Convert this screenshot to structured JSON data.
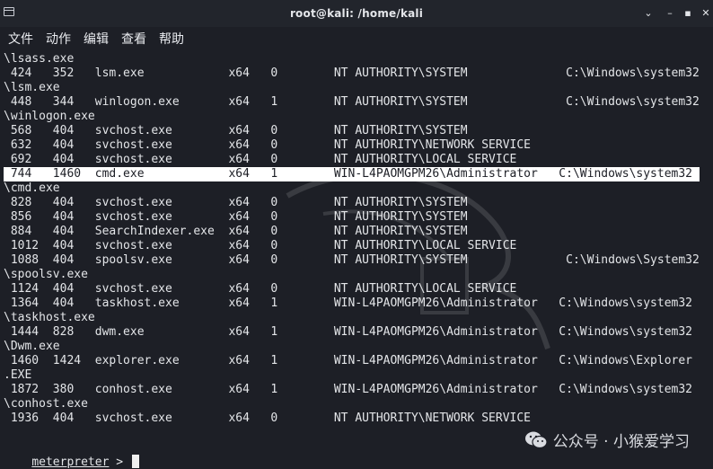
{
  "window": {
    "title": "root@kali: /home/kali",
    "controls": [
      "⌄",
      "–",
      "▪",
      "✕"
    ]
  },
  "menu": [
    "文件",
    "动作",
    "编辑",
    "查看",
    "帮助"
  ],
  "lines": [
    "\\lsass.exe",
    " 424   352   lsm.exe            x64   0        NT AUTHORITY\\SYSTEM              C:\\Windows\\system32",
    "\\lsm.exe",
    " 448   344   winlogon.exe       x64   1        NT AUTHORITY\\SYSTEM              C:\\Windows\\system32",
    "\\winlogon.exe",
    " 568   404   svchost.exe        x64   0        NT AUTHORITY\\SYSTEM",
    " 632   404   svchost.exe        x64   0        NT AUTHORITY\\NETWORK SERVICE",
    " 692   404   svchost.exe        x64   0        NT AUTHORITY\\LOCAL SERVICE",
    " 744   1460  cmd.exe            x64   1        WIN-L4PAOMGPM26\\Administrator   C:\\Windows\\system32",
    "\\cmd.exe",
    " 828   404   svchost.exe        x64   0        NT AUTHORITY\\SYSTEM",
    " 856   404   svchost.exe        x64   0        NT AUTHORITY\\SYSTEM",
    " 884   404   SearchIndexer.exe  x64   0        NT AUTHORITY\\SYSTEM",
    " 1012  404   svchost.exe        x64   0        NT AUTHORITY\\LOCAL SERVICE",
    " 1088  404   spoolsv.exe        x64   0        NT AUTHORITY\\SYSTEM              C:\\Windows\\System32",
    "\\spoolsv.exe",
    " 1124  404   svchost.exe        x64   0        NT AUTHORITY\\LOCAL SERVICE",
    " 1364  404   taskhost.exe       x64   1        WIN-L4PAOMGPM26\\Administrator   C:\\Windows\\system32",
    "\\taskhost.exe",
    " 1444  828   dwm.exe            x64   1        WIN-L4PAOMGPM26\\Administrator   C:\\Windows\\system32",
    "\\Dwm.exe",
    " 1460  1424  explorer.exe       x64   1        WIN-L4PAOMGPM26\\Administrator   C:\\Windows\\Explorer",
    ".EXE",
    " 1872  380   conhost.exe        x64   1        WIN-L4PAOMGPM26\\Administrator   C:\\Windows\\system32",
    "\\conhost.exe",
    " 1936  404   svchost.exe        x64   0        NT AUTHORITY\\NETWORK SERVICE"
  ],
  "highlight_row": 8,
  "prompt": {
    "label": "meterpreter",
    "symbol": " > "
  },
  "watermark": "公众号 · 小猴爱学习"
}
